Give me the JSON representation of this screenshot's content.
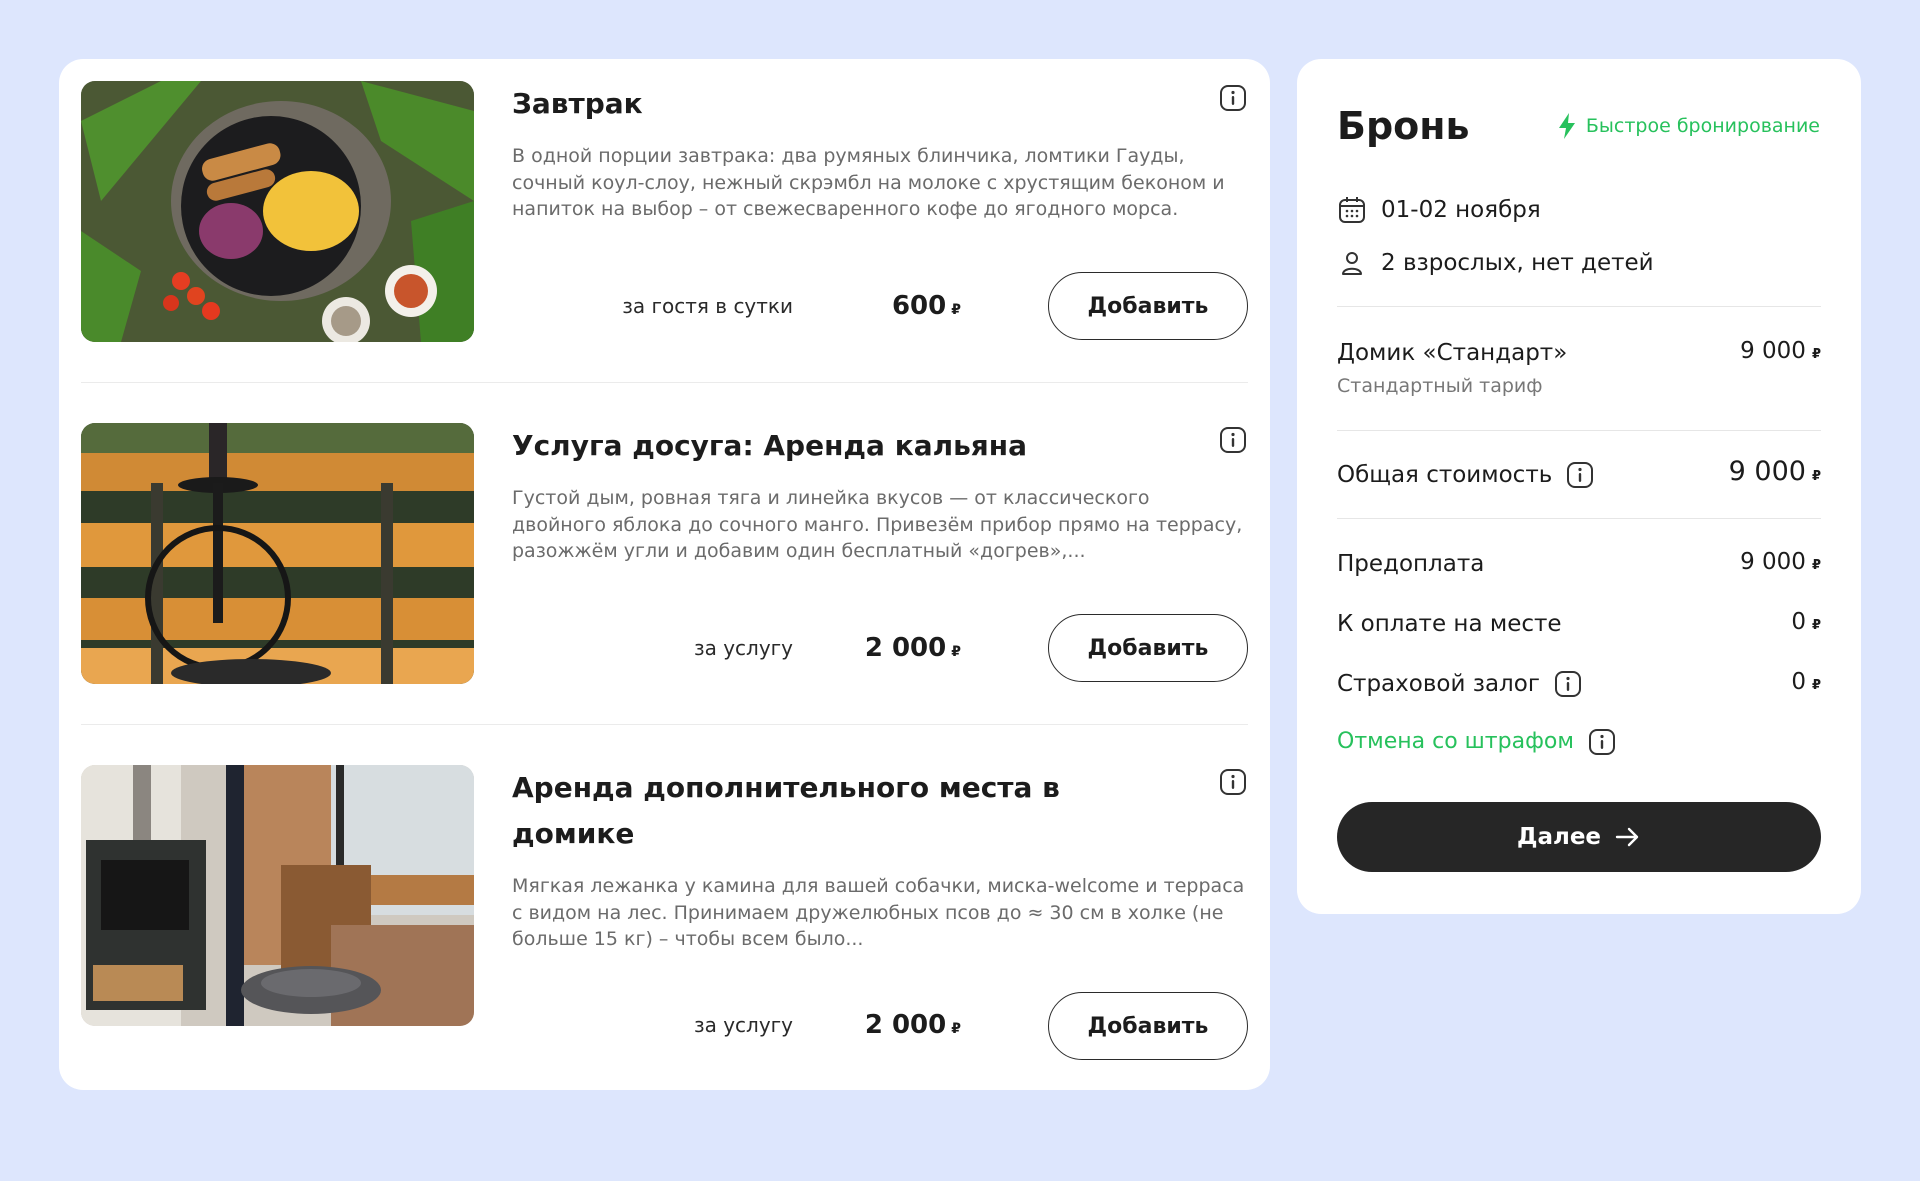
{
  "services": [
    {
      "title": "Завтрак",
      "description": "В одной порции завтрака: два румяных блинчика, ломтики Гауды, сочный коул-слоу, нежный скрэмбл на молоке с хрустящим беконом и напиток на выбор – от свежесваренного кофе до ягодного морса.",
      "unit": "за гостя в сутки",
      "price": "600",
      "currency": "₽",
      "add_label": "Добавить"
    },
    {
      "title": "Услуга досуга: Аренда кальяна",
      "description": "Густой дым, ровная тяга и линейка вкусов — от классического двойного яблока до сочного манго. Привезём прибор прямо на террасу, разожжём угли и добавим один бесплатный «догрев»,...",
      "unit": "за услугу",
      "price": "2 000",
      "currency": "₽",
      "add_label": "Добавить"
    },
    {
      "title": "Аренда дополнительного места в домике",
      "description": "Мягкая лежанка у камина для вашей собачки, миска-welcome и терраса с видом на лес. Принимаем дружелюбных псов до ≈ 30 см в холке (не больше 15 кг) – чтобы всем было...",
      "unit": "за услугу",
      "price": "2 000",
      "currency": "₽",
      "add_label": "Добавить"
    }
  ],
  "booking": {
    "title": "Бронь",
    "fast_booking": "Быстрое бронирование",
    "dates": "01-02 ноября",
    "guests": "2 взрослых, нет детей",
    "room_name": "Домик «Стандарт»",
    "room_price": "9 000",
    "tariff": "Стандартный тариф",
    "total_label": "Общая стоимость",
    "total_value": "9 000",
    "prepayment_label": "Предоплата",
    "prepayment_value": "9 000",
    "onsite_label": "К оплате на месте",
    "onsite_value": "0",
    "deposit_label": "Страховой залог",
    "deposit_value": "0",
    "cancel_label": "Отмена со штрафом",
    "currency": "₽",
    "next_label": "Далее"
  },
  "colors": {
    "background": "#dde6fd",
    "accent_green": "#27c15c",
    "dark_button": "#262626"
  }
}
